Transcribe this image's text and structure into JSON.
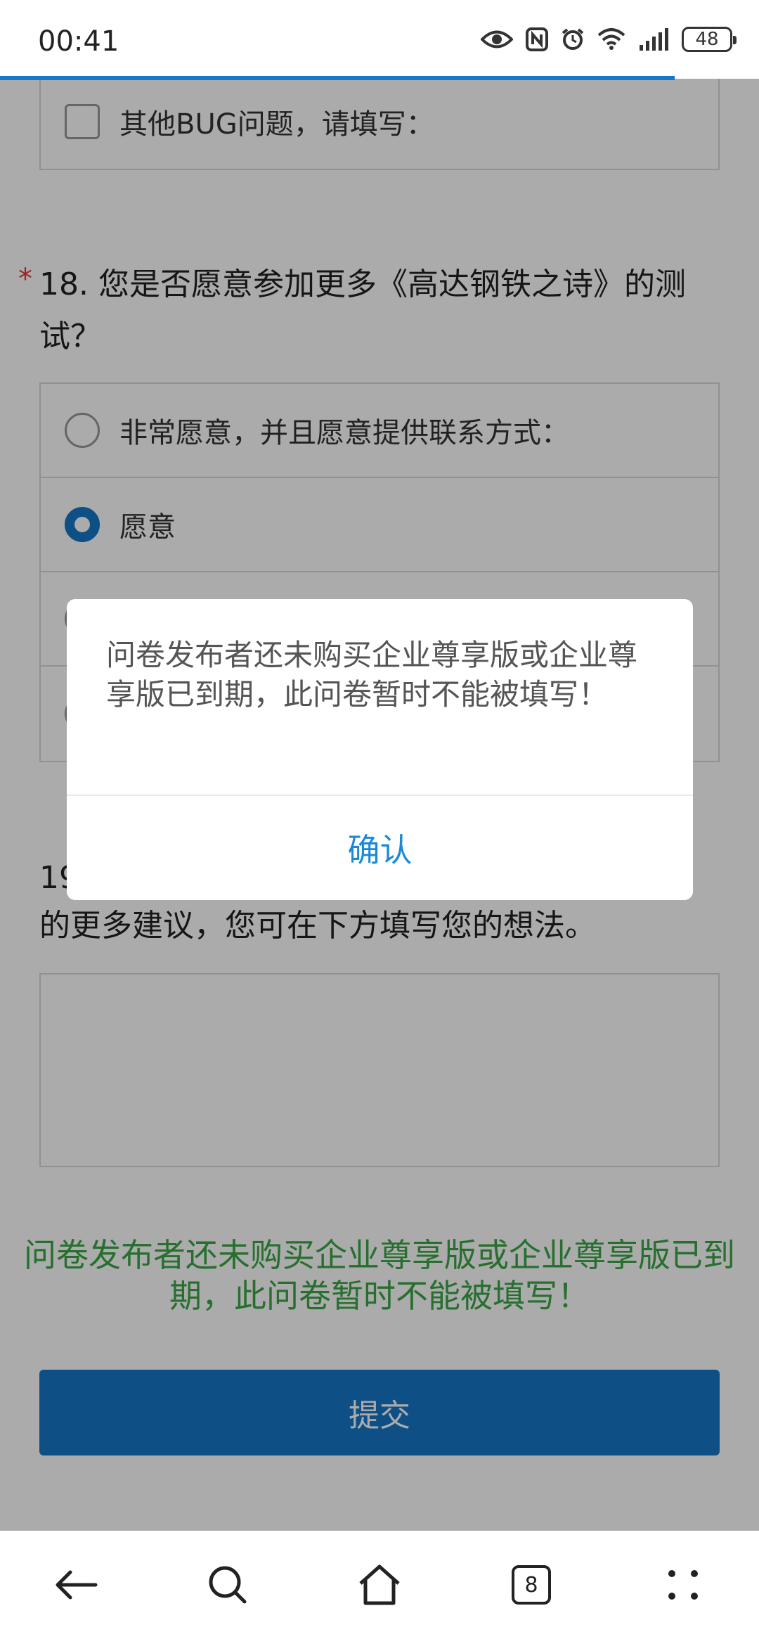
{
  "status_bar": {
    "time": "00:41",
    "battery": "48",
    "icons": [
      "eye-icon",
      "nfc-icon",
      "alarm-icon",
      "wifi-icon",
      "signal-icon",
      "battery-icon"
    ]
  },
  "survey": {
    "q17_other_option": "其他BUG问题，请填写：",
    "q18": {
      "required_mark": "*",
      "title": "18. 您是否愿意参加更多《高达钢铁之诗》的测试？",
      "options": [
        {
          "label": "非常愿意，并且愿意提供联系方式：",
          "selected": false
        },
        {
          "label": "愿意",
          "selected": true
        },
        {
          "label": "",
          "selected": false
        },
        {
          "label": "",
          "selected": false
        }
      ]
    },
    "q19": {
      "title_visible_start": "19",
      "title_visible_end": "的更多建议，您可在下方填写您的想法。"
    },
    "notice": "问卷发布者还未购买企业尊享版或企业尊享版已到期，此问卷暂时不能被填写！",
    "submit_label": "提交"
  },
  "dialog": {
    "message": "问卷发布者还未购买企业尊享版或企业尊享版已到期，此问卷暂时不能被填写！",
    "confirm_label": "确认"
  },
  "nav_bar": {
    "tab_count": "8",
    "items": [
      "back-arrow-icon",
      "search-icon",
      "home-icon",
      "tabs-icon",
      "menu-icon"
    ]
  },
  "colors": {
    "accent": "#1677c8",
    "notice_green": "#3aa645",
    "required_red": "#e53935",
    "confirm_blue": "#1a8ad8"
  }
}
